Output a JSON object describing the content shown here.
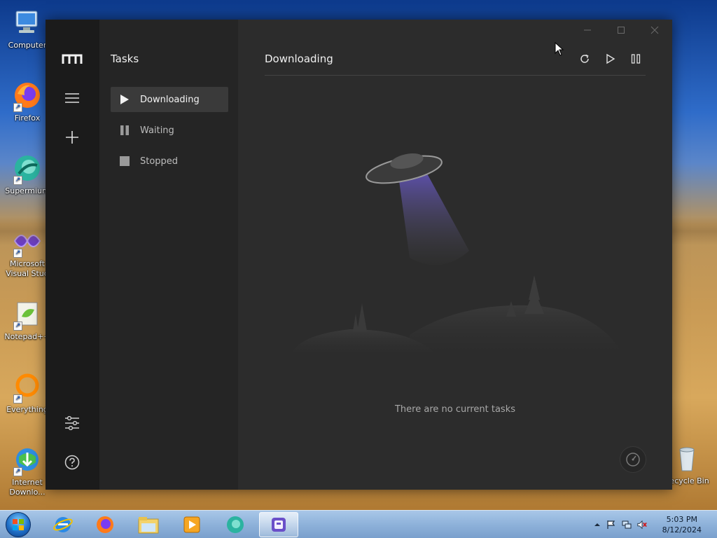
{
  "desktop": {
    "icons": [
      {
        "label": "Computer",
        "icon": "computer-icon"
      },
      {
        "label": "Firefox",
        "icon": "firefox-icon"
      },
      {
        "label": "Supermium",
        "icon": "supermium-icon"
      },
      {
        "label": "Microsoft Visual Stud",
        "icon": "visual-studio-icon"
      },
      {
        "label": "Notepad++",
        "icon": "notepad-plus-plus-icon"
      },
      {
        "label": "Everything",
        "icon": "everything-search-icon"
      },
      {
        "label": "Internet Downlo...",
        "icon": "internet-download-manager-icon"
      },
      {
        "label": "Recycle Bin",
        "icon": "recycle-bin-icon"
      }
    ]
  },
  "app": {
    "nav_title": "Tasks",
    "nav_items": [
      {
        "label": "Downloading",
        "icon": "play-icon",
        "active": true
      },
      {
        "label": "Waiting",
        "icon": "pause-icon",
        "active": false
      },
      {
        "label": "Stopped",
        "icon": "stop-icon",
        "active": false
      }
    ],
    "main_title": "Downloading",
    "empty_text": "There are no current tasks",
    "toolbar_icons": [
      "refresh-icon",
      "play-icon",
      "pause-icon"
    ],
    "accent": "#6a5acd"
  },
  "taskbar": {
    "items": [
      "internet-explorer-icon",
      "firefox-icon",
      "file-explorer-icon",
      "media-player-icon",
      "supermium-icon",
      "motrix-icon"
    ],
    "active_item": "motrix-icon",
    "time": "5:03 PM",
    "date": "8/12/2024"
  }
}
